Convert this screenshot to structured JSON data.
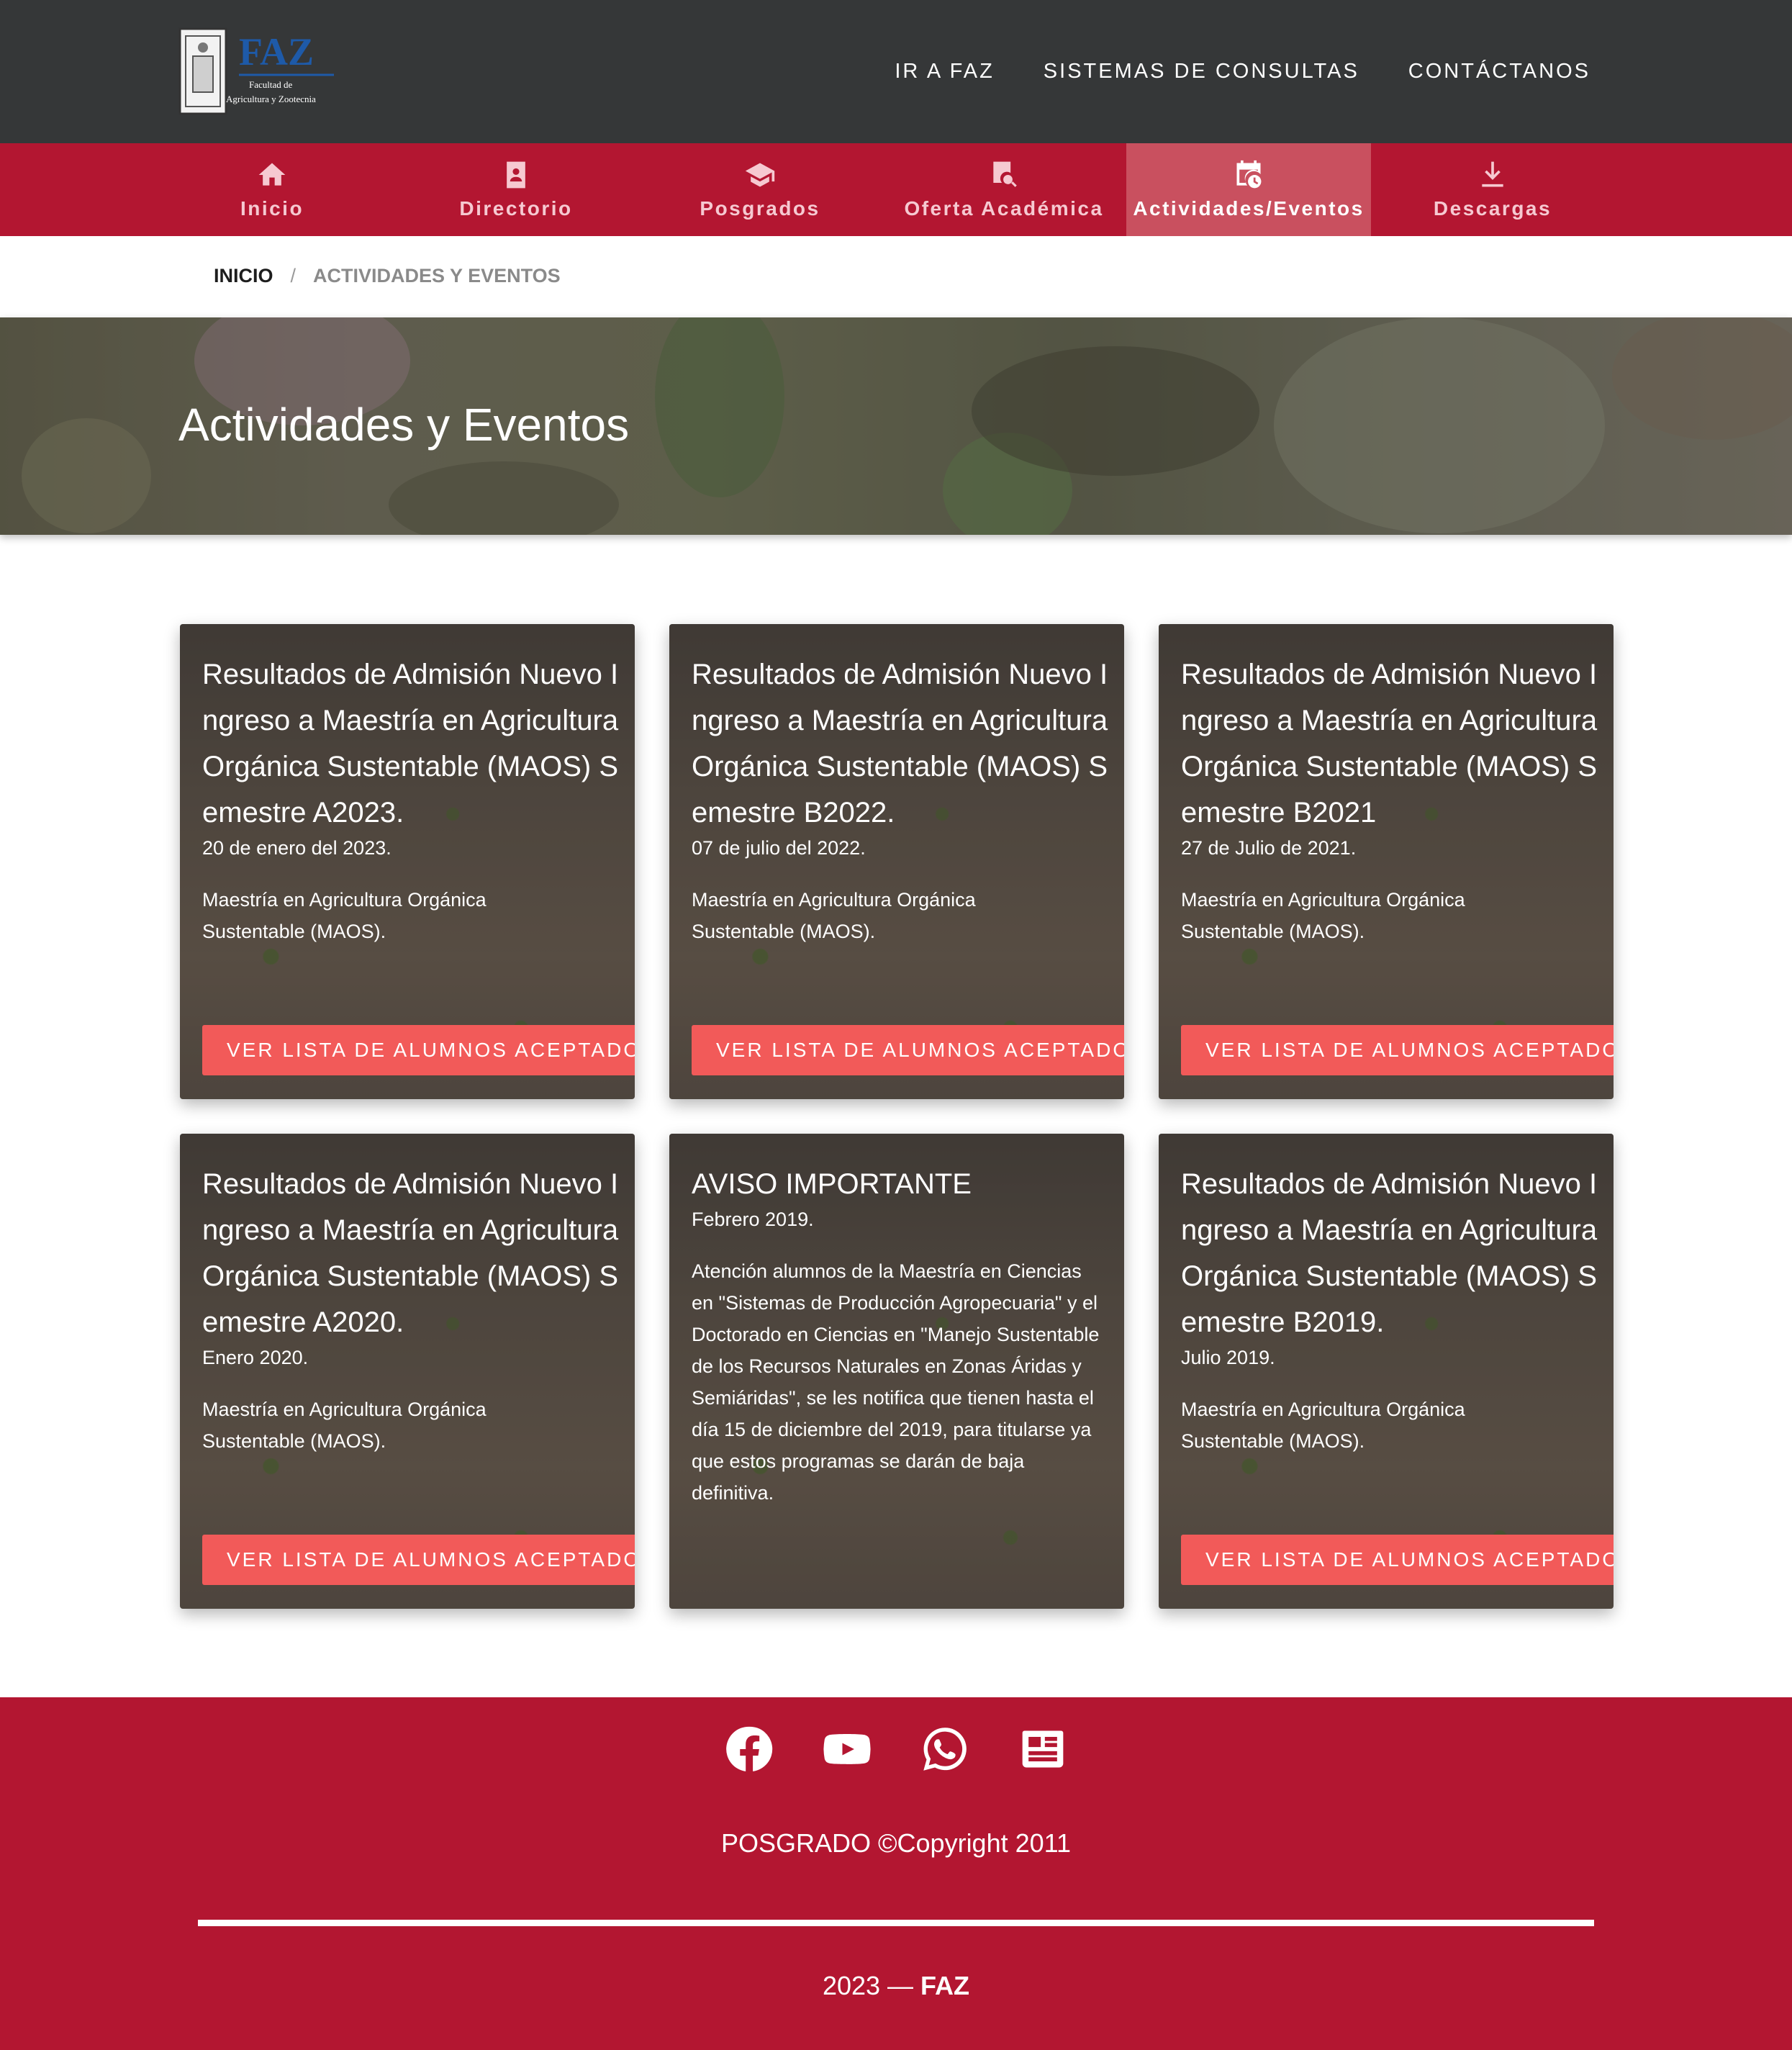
{
  "header": {
    "logo_text": "FAZ",
    "logo_subtitle": "Facultad de Agricultura y Zootecnia",
    "nav": [
      "IR A FAZ",
      "SISTEMAS DE CONSULTAS",
      "CONTÁCTANOS"
    ]
  },
  "tabs": [
    {
      "label": "Inicio",
      "icon": "home-icon",
      "active": false
    },
    {
      "label": "Directorio",
      "icon": "contact-book-icon",
      "active": false
    },
    {
      "label": "Posgrados",
      "icon": "graduation-cap-icon",
      "active": false
    },
    {
      "label": "Oferta Académica",
      "icon": "book-search-icon",
      "active": false
    },
    {
      "label": "Actividades/Eventos",
      "icon": "calendar-clock-icon",
      "active": true
    },
    {
      "label": "Descargas",
      "icon": "download-icon",
      "active": false
    }
  ],
  "breadcrumb": {
    "home": "INICIO",
    "separator": "/",
    "current": "ACTIVIDADES Y EVENTOS"
  },
  "hero": {
    "title": "Actividades y Eventos"
  },
  "cards": [
    {
      "title": "Resultados de Admisión Nuevo Ingreso a Maestría en Agricultura Orgánica Sustentable (MAOS) Semestre A2023.",
      "date": "20 de enero del 2023.",
      "desc": "Maestría en Agricultura Orgánica Sustentable (MAOS).",
      "button": "VER LISTA DE ALUMNOS ACEPTADOS"
    },
    {
      "title": "Resultados de Admisión Nuevo Ingreso a Maestría en Agricultura Orgánica Sustentable (MAOS) Semestre B2022.",
      "date": "07 de julio del 2022.",
      "desc": "Maestría en Agricultura Orgánica Sustentable (MAOS).",
      "button": "VER LISTA DE ALUMNOS ACEPTADOS"
    },
    {
      "title": "Resultados de Admisión Nuevo Ingreso a Maestría en Agricultura Orgánica Sustentable (MAOS) Semestre B2021",
      "date": "27 de Julio de 2021.",
      "desc": "Maestría en Agricultura Orgánica Sustentable (MAOS).",
      "button": "VER LISTA DE ALUMNOS ACEPTADOS"
    },
    {
      "title": "Resultados de Admisión Nuevo Ingreso a Maestría en Agricultura Orgánica Sustentable (MAOS) Semestre A2020.",
      "date": "Enero 2020.",
      "desc": "Maestría en Agricultura Orgánica Sustentable (MAOS).",
      "button": "VER LISTA DE ALUMNOS ACEPTADOS"
    },
    {
      "title": "AVISO IMPORTANTE",
      "date": "Febrero 2019.",
      "desc": "Atención alumnos de la Maestría en Ciencias en \"Sistemas de Producción Agropecuaria\" y el Doctorado en Ciencias en \"Manejo Sustentable de los Recursos Naturales en Zonas Áridas y Semiáridas\", se les notifica que tienen hasta el día 15 de diciembre del 2019, para titularse ya que estos programas se darán de baja definitiva.",
      "button": ""
    },
    {
      "title": "Resultados de Admisión Nuevo Ingreso a Maestría en Agricultura Orgánica Sustentable (MAOS) Semestre B2019.",
      "date": "Julio 2019.",
      "desc": "Maestría en Agricultura Orgánica Sustentable (MAOS).",
      "button": "VER LISTA DE ALUMNOS ACEPTADOS"
    }
  ],
  "footer": {
    "social": [
      "facebook-icon",
      "youtube-icon",
      "whatsapp-icon",
      "newspaper-icon"
    ],
    "copyright": "POSGRADO ©Copyright 2011",
    "year": "2023 —",
    "brand": "FAZ"
  },
  "colors": {
    "header_bg": "#353738",
    "brand_red": "#b31631",
    "active_tab": "#c9505f",
    "button": "#f25a59"
  }
}
